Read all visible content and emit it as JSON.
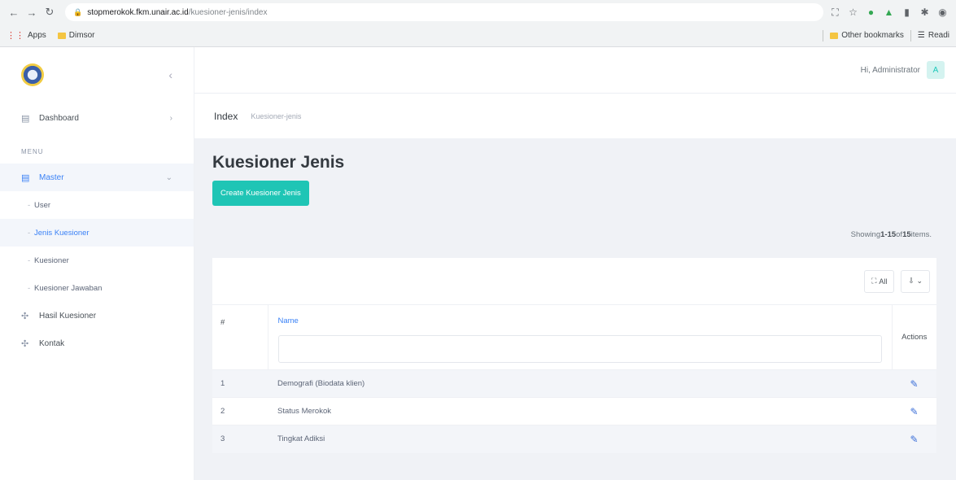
{
  "browser": {
    "url_host": "stopmerokok.fkm.unair.ac.id",
    "url_path": "/kuesioner-jenis/index",
    "bookmarks": [
      {
        "icon": "apps-grid-icon",
        "label": "Apps"
      },
      {
        "icon": "folder-icon",
        "label": "Dimsor"
      }
    ],
    "bookmarks_right": [
      {
        "icon": "folder-icon",
        "label": "Other bookmarks"
      },
      {
        "icon": "reading-list-icon",
        "label": "Readi"
      }
    ]
  },
  "sidebar": {
    "dashboard_label": "Dashboard",
    "menu_title": "MENU",
    "master_label": "Master",
    "master_items": [
      {
        "label": "User",
        "active": false
      },
      {
        "label": "Jenis Kuesioner",
        "active": true
      },
      {
        "label": "Kuesioner",
        "active": false
      },
      {
        "label": "Kuesioner Jawaban",
        "active": false
      }
    ],
    "hasil_label": "Hasil Kuesioner",
    "kontak_label": "Kontak"
  },
  "topbar": {
    "greeting": "Hi, Administrator",
    "avatar_letter": "A"
  },
  "breadcrumb": {
    "title": "Index",
    "path": "Kuesioner-jenis"
  },
  "page": {
    "heading": "Kuesioner Jenis",
    "create_button": "Create Kuesioner Jenis",
    "summary_prefix": "Showing ",
    "summary_range": "1-15",
    "summary_mid": " of ",
    "summary_total": "15",
    "summary_suffix": " items.",
    "all_button": "All",
    "export_button": "⇩ ⌄"
  },
  "table": {
    "col_num": "#",
    "col_name": "Name",
    "col_actions": "Actions",
    "rows": [
      {
        "num": "1",
        "name": "Demografi (Biodata klien)"
      },
      {
        "num": "2",
        "name": "Status Merokok"
      },
      {
        "num": "3",
        "name": "Tingkat Adiksi"
      }
    ]
  },
  "colors": {
    "accent_teal": "#1fc5b5",
    "link_blue": "#3b82f6"
  }
}
